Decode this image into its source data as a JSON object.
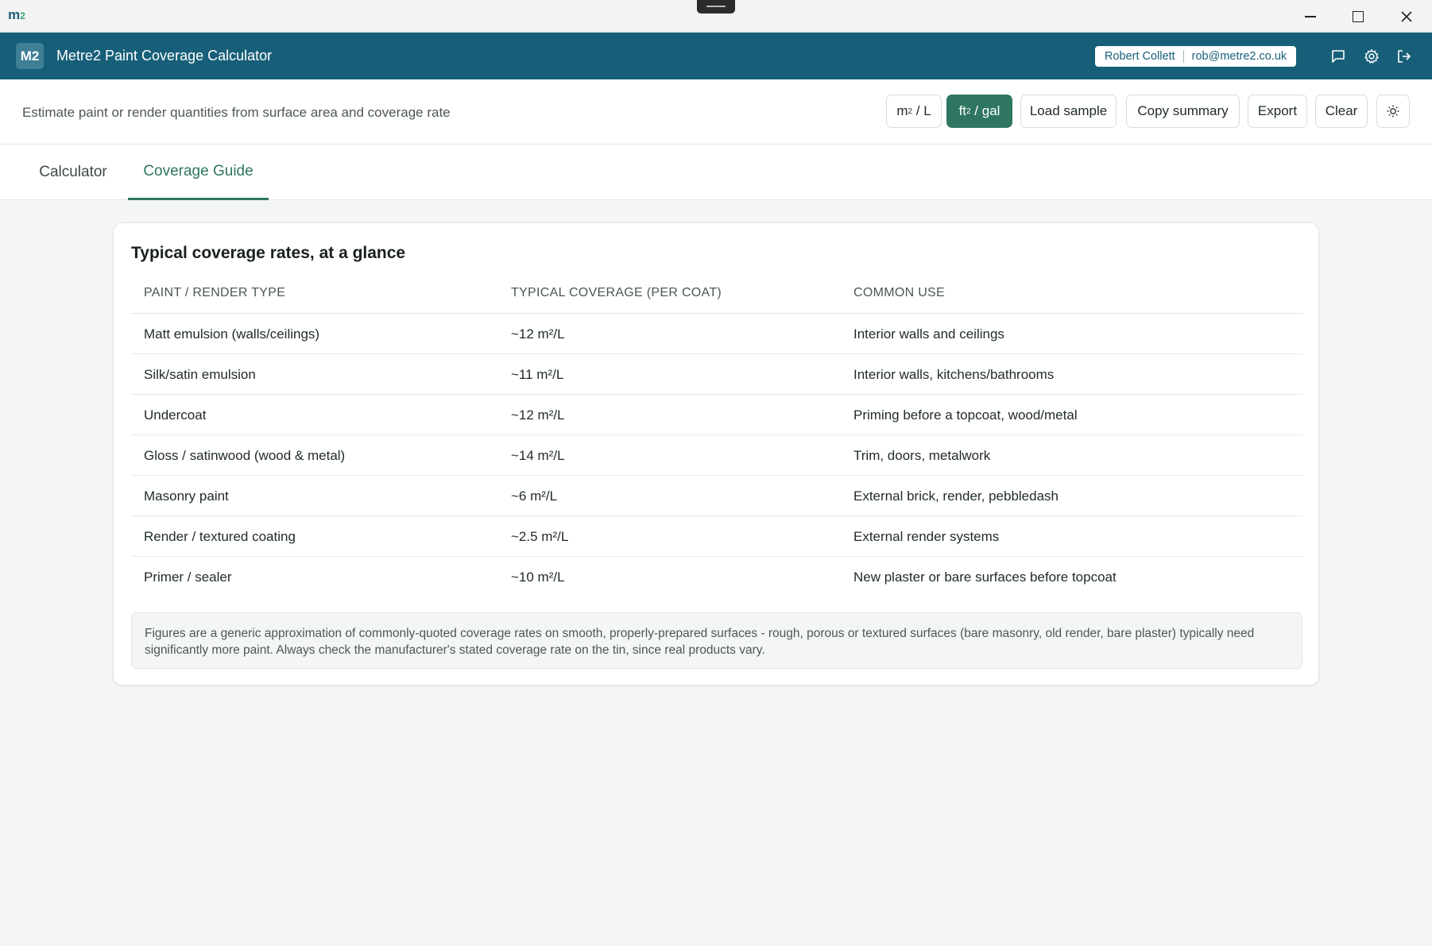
{
  "os": {
    "logo_m": "m",
    "logo_2": "2"
  },
  "header": {
    "badge": "M2",
    "title": "Metre2 Paint Coverage Calculator",
    "user_name": "Robert Collett",
    "user_email": "rob@metre2.co.uk"
  },
  "toolbar": {
    "subtitle": "Estimate paint or render quantities from surface area and coverage rate",
    "unit_metric": {
      "base": "m",
      "sup": "2",
      "rest": " / L"
    },
    "unit_imperial": {
      "base": "ft",
      "sup": "2",
      "rest": " / gal",
      "active": true
    },
    "load_sample": "Load sample",
    "copy_summary": "Copy summary",
    "export": "Export",
    "clear": "Clear"
  },
  "tabs": [
    {
      "label": "Calculator",
      "active": false
    },
    {
      "label": "Coverage Guide",
      "active": true
    }
  ],
  "guide": {
    "title": "Typical coverage rates, at a glance",
    "columns": [
      "PAINT / RENDER TYPE",
      "TYPICAL COVERAGE (PER COAT)",
      "COMMON USE"
    ],
    "rows": [
      {
        "type": "Matt emulsion (walls/ceilings)",
        "coverage": "~12 m²/L",
        "use": "Interior walls and ceilings"
      },
      {
        "type": "Silk/satin emulsion",
        "coverage": "~11 m²/L",
        "use": "Interior walls, kitchens/bathrooms"
      },
      {
        "type": "Undercoat",
        "coverage": "~12 m²/L",
        "use": "Priming before a topcoat, wood/metal"
      },
      {
        "type": "Gloss / satinwood (wood & metal)",
        "coverage": "~14 m²/L",
        "use": "Trim, doors, metalwork"
      },
      {
        "type": "Masonry paint",
        "coverage": "~6 m²/L",
        "use": "External brick, render, pebbledash"
      },
      {
        "type": "Render / textured coating",
        "coverage": "~2.5 m²/L",
        "use": "External render systems"
      },
      {
        "type": "Primer / sealer",
        "coverage": "~10 m²/L",
        "use": "New plaster or bare surfaces before topcoat"
      }
    ],
    "note": "Figures are a generic approximation of commonly-quoted coverage rates on smooth, properly-prepared surfaces - rough, porous or textured surfaces (bare masonry, old render, bare plaster) typically need significantly more paint. Always check the manufacturer's stated coverage rate on the tin, since real products vary."
  },
  "colors": {
    "header_bg": "#175f79",
    "accent": "#2e7661"
  }
}
